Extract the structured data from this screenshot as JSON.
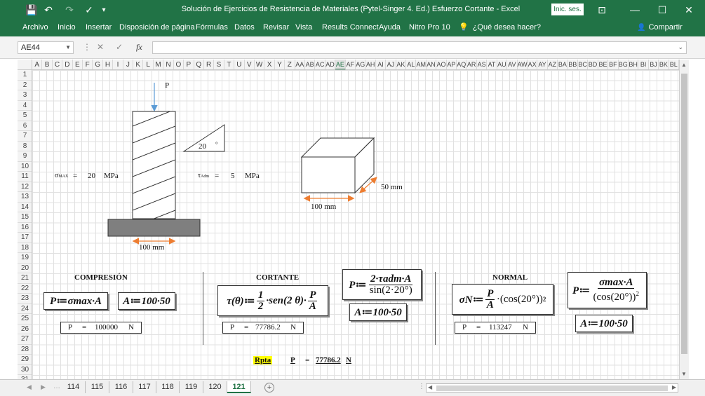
{
  "titlebar": {
    "title": "Solución de Ejercicios de Resistencia de Materiales (Pytel-Singer 4. Ed.) Esfuerzo Cortante  -  Excel",
    "signin": "Inic. ses.",
    "qat": {
      "save": "💾",
      "undo": "↶",
      "redo": "↷",
      "spell": "✓",
      "custom": "▾"
    },
    "controls": {
      "ribbon_display": "⊡",
      "minimize": "—",
      "maximize": "☐",
      "close": "✕"
    }
  },
  "ribbon": {
    "tabs": [
      "Archivo",
      "Inicio",
      "Insertar",
      "Disposición de página",
      "Fórmulas",
      "Datos",
      "Revisar",
      "Vista",
      "Results Connect",
      "Ayuda",
      "Nitro Pro 10"
    ],
    "tell_me": "¿Qué desea hacer?",
    "tell_icon": "💡",
    "share": "Compartir",
    "share_icon": "👤"
  },
  "formula_bar": {
    "name_box": "AE44",
    "cancel": "✕",
    "enter": "✓",
    "fx": "fx",
    "formula": ""
  },
  "columns": [
    "A",
    "B",
    "C",
    "D",
    "E",
    "F",
    "G",
    "H",
    "I",
    "J",
    "K",
    "L",
    "M",
    "N",
    "O",
    "P",
    "Q",
    "R",
    "S",
    "T",
    "U",
    "V",
    "W",
    "X",
    "Y",
    "Z",
    "AA",
    "AB",
    "AC",
    "AD",
    "AE",
    "AF",
    "AG",
    "AH",
    "AI",
    "AJ",
    "AK",
    "AL",
    "AM",
    "AN",
    "AO",
    "AP",
    "AQ",
    "AR",
    "AS",
    "AT",
    "AU",
    "AV",
    "AW",
    "AX",
    "AY",
    "AZ",
    "BA",
    "BB",
    "BC",
    "BD",
    "BE",
    "BF",
    "BG",
    "BH",
    "BI",
    "BJ",
    "BK",
    "BL"
  ],
  "selected_column": "AE",
  "rows": [
    "1",
    "2",
    "3",
    "4",
    "5",
    "6",
    "7",
    "8",
    "9",
    "10",
    "11",
    "12",
    "13",
    "14",
    "15",
    "16",
    "17",
    "18",
    "19",
    "20",
    "21",
    "22",
    "23",
    "24",
    "25",
    "26",
    "27",
    "28",
    "29",
    "30",
    "31"
  ],
  "drawing": {
    "load_label": "P",
    "angle_value": "20",
    "angle_unit": "°",
    "sigma_symbol": "σ",
    "sigma_sub": "MAX",
    "sigma_eq": "=",
    "sigma_value": "20",
    "sigma_unit": "MPa",
    "tau_symbol": "τ",
    "tau_sub": "Adm",
    "tau_eq": "=",
    "tau_value": "5",
    "tau_unit": "MPa",
    "column_width": "100 mm",
    "box_depth": "50   mm",
    "box_width": "100 mm"
  },
  "sections": {
    "compresion": {
      "title": "COMPRESIÓN",
      "formula_p": "P≔σmax·A",
      "formula_a": "A≔100·50",
      "result_var": "P",
      "result_eq": "=",
      "result_value": "100000",
      "result_unit": "N"
    },
    "cortante": {
      "title": "CORTANTE",
      "tau_lhs": "τ(θ)≔",
      "tau_frac_num": "1",
      "tau_frac_den": "2",
      "tau_mid": "·sen(2 θ)·",
      "tau_frac2_num": "P",
      "tau_frac2_den": "A",
      "p_lhs": "P≔",
      "p_num": "2·τadm·A",
      "p_den": "sin(2·20°)",
      "formula_a": "A≔100·50",
      "result_var": "P",
      "result_eq": "=",
      "result_value": "77786.2",
      "result_unit": "N"
    },
    "normal": {
      "title": "NORMAL",
      "sn_lhs": "σN≔",
      "sn_num": "P",
      "sn_den": "A",
      "sn_rest": "·(cos(20°))",
      "sn_exp": "2",
      "p_lhs": "P≔",
      "p_num": "σmax·A",
      "p_den": "(cos(20°))",
      "p_exp": "2",
      "formula_a": "A≔100·50",
      "result_var": "P",
      "result_eq": "=",
      "result_value": "113247",
      "result_unit": "N"
    }
  },
  "answer": {
    "label": "Rpta",
    "var": "P",
    "eq": "=",
    "value": "77786.2",
    "unit": "N"
  },
  "sheet_tabs": [
    "114",
    "115",
    "116",
    "117",
    "118",
    "119",
    "120",
    "121"
  ],
  "active_sheet": "121",
  "colors": {
    "excel_green": "#217346",
    "highlight": "#ffff00",
    "arrow_orange": "#ed7d31",
    "arrow_blue": "#5b9bd5",
    "base_gray": "#7f7f7f"
  }
}
